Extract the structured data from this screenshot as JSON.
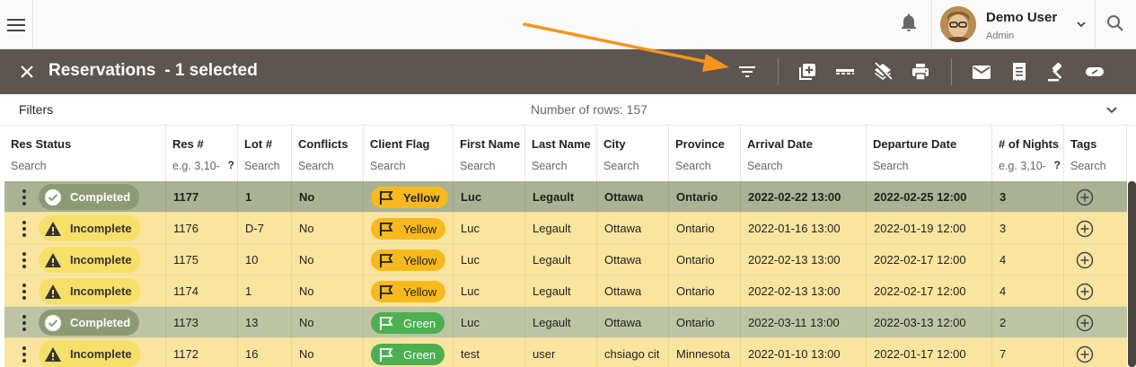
{
  "user": {
    "name": "Demo User",
    "role": "Admin"
  },
  "titlebar": {
    "title": "Reservations",
    "selected_text": "- 1 selected"
  },
  "filters": {
    "label": "Filters",
    "row_count": "Number of rows: 157"
  },
  "columns": [
    {
      "label": "Res Status",
      "search": "Search"
    },
    {
      "label": "Res #",
      "search": "e.g. 3,10-",
      "help": "?"
    },
    {
      "label": "Lot #",
      "search": "Search"
    },
    {
      "label": "Conflicts",
      "search": "Search"
    },
    {
      "label": "Client Flag",
      "search": "Search"
    },
    {
      "label": "First Name",
      "search": "Search"
    },
    {
      "label": "Last Name",
      "search": "Search"
    },
    {
      "label": "City",
      "search": "Search"
    },
    {
      "label": "Province",
      "search": "Search"
    },
    {
      "label": "Arrival Date",
      "search": "Search"
    },
    {
      "label": "Departure Date",
      "search": "Search"
    },
    {
      "label": "# of Nights",
      "search": "e.g. 3,10-",
      "help": "?"
    },
    {
      "label": "Tags",
      "search": "Search"
    }
  ],
  "rows": [
    {
      "status": "Completed",
      "res": "1177",
      "lot": "1",
      "conflicts": "No",
      "flag": "Yellow",
      "first": "Luc",
      "last": "Legault",
      "city": "Ottawa",
      "province": "Ontario",
      "arrival": "2022-02-22 13:00",
      "departure": "2022-02-25 12:00",
      "nights": "3"
    },
    {
      "status": "Incomplete",
      "res": "1176",
      "lot": "D-7",
      "conflicts": "No",
      "flag": "Yellow",
      "first": "Luc",
      "last": "Legault",
      "city": "Ottawa",
      "province": "Ontario",
      "arrival": "2022-01-16 13:00",
      "departure": "2022-01-19 12:00",
      "nights": "3"
    },
    {
      "status": "Incomplete",
      "res": "1175",
      "lot": "10",
      "conflicts": "No",
      "flag": "Yellow",
      "first": "Luc",
      "last": "Legault",
      "city": "Ottawa",
      "province": "Ontario",
      "arrival": "2022-02-13 13:00",
      "departure": "2022-02-17 12:00",
      "nights": "4"
    },
    {
      "status": "Incomplete",
      "res": "1174",
      "lot": "1",
      "conflicts": "No",
      "flag": "Yellow",
      "first": "Luc",
      "last": "Legault",
      "city": "Ottawa",
      "province": "Ontario",
      "arrival": "2022-02-13 13:00",
      "departure": "2022-02-17 12:00",
      "nights": "4"
    },
    {
      "status": "Completed",
      "res": "1173",
      "lot": "13",
      "conflicts": "No",
      "flag": "Green",
      "first": "Luc",
      "last": "Legault",
      "city": "Ottawa",
      "province": "Ontario",
      "arrival": "2022-03-11 13:00",
      "departure": "2022-03-13 12:00",
      "nights": "2"
    },
    {
      "status": "Incomplete",
      "res": "1172",
      "lot": "16",
      "conflicts": "No",
      "flag": "Green",
      "first": "test",
      "last": "user",
      "city": "chsiago cit",
      "province": "Minnesota",
      "arrival": "2022-01-10 13:00",
      "departure": "2022-01-17 12:00",
      "nights": "7"
    }
  ],
  "selected_row_index": 0,
  "colors": {
    "titlebar": "#5d5650",
    "completed_row": "#bcc4a4",
    "incomplete_row": "#fae59e",
    "flag_yellow": "#f8b91e",
    "flag_green": "#4caf50",
    "annotation_arrow": "#f7941d"
  },
  "toolbar_icons": [
    "filter-icon",
    "add-box-icon",
    "separator-icon",
    "layers-clear-icon",
    "print-icon",
    "mail-icon",
    "receipt-icon",
    "gavel-icon",
    "tag-icon"
  ]
}
